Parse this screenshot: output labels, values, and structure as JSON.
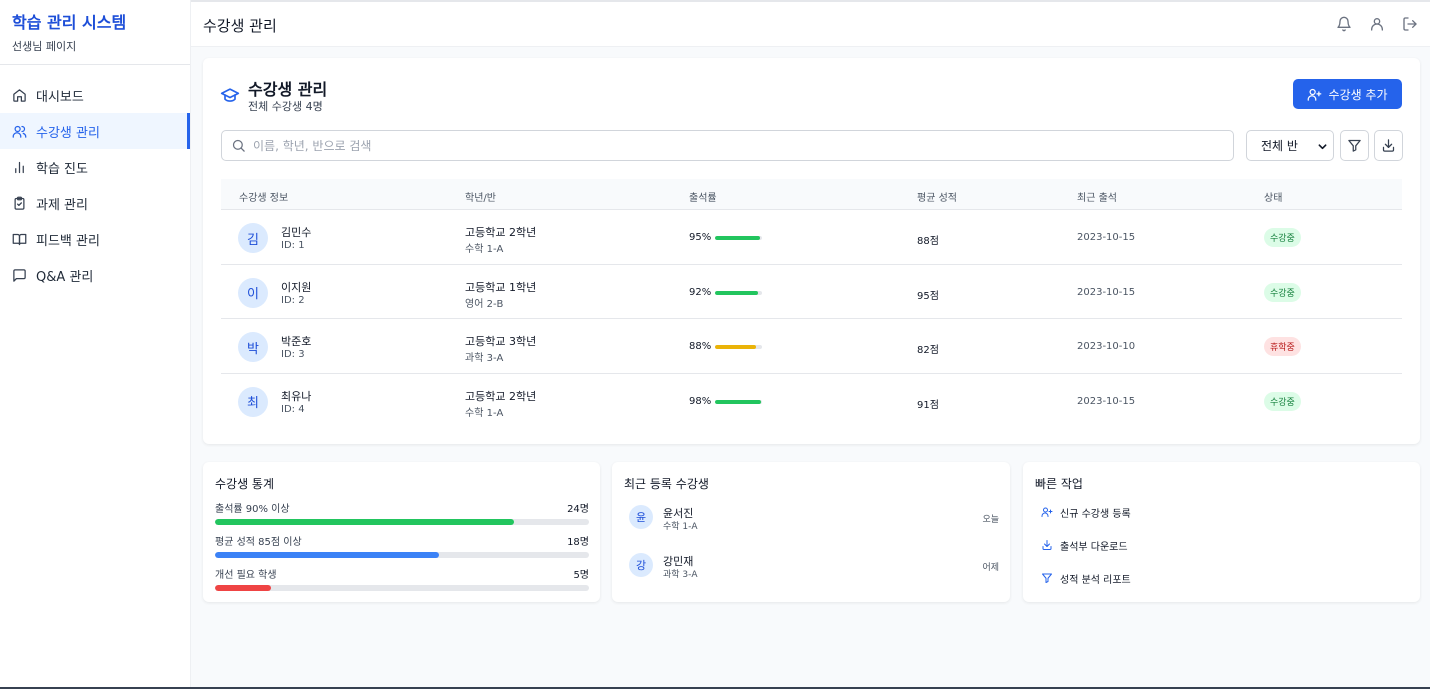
{
  "sidebar": {
    "brand_title": "학습 관리 시스템",
    "brand_sub": "선생님 페이지",
    "items": [
      {
        "label": "대시보드",
        "icon": "home-icon"
      },
      {
        "label": "수강생 관리",
        "icon": "users-icon",
        "active": true
      },
      {
        "label": "학습 진도",
        "icon": "bar-chart-icon"
      },
      {
        "label": "과제 관리",
        "icon": "clipboard-icon"
      },
      {
        "label": "피드백 관리",
        "icon": "book-icon"
      },
      {
        "label": "Q&A 관리",
        "icon": "message-icon"
      }
    ]
  },
  "header": {
    "title": "수강생 관리",
    "icons": [
      "bell-icon",
      "user-icon",
      "logout-icon"
    ]
  },
  "main": {
    "title": "수강생 관리",
    "subtitle": "전체 수강생 4명",
    "add_button": "수강생 추가",
    "search_placeholder": "이름, 학년, 반으로 검색",
    "select_value": "전체 반",
    "columns": [
      "수강생 정보",
      "학년/반",
      "출석률",
      "평균 성적",
      "최근 출석",
      "상태"
    ],
    "rows": [
      {
        "initial": "김",
        "name": "김민수",
        "id": "ID: 1",
        "grade": "고등학교 2학년",
        "class": "수학 1-A",
        "attendance": "95%",
        "attendance_value": 95,
        "score": "88점",
        "last": "2023-10-15",
        "status": "수강중",
        "status_type": "green",
        "bar_color": "#22c55e"
      },
      {
        "initial": "이",
        "name": "이지원",
        "id": "ID: 2",
        "grade": "고등학교 1학년",
        "class": "영어 2-B",
        "attendance": "92%",
        "attendance_value": 92,
        "score": "95점",
        "last": "2023-10-15",
        "status": "수강중",
        "status_type": "green",
        "bar_color": "#22c55e"
      },
      {
        "initial": "박",
        "name": "박준호",
        "id": "ID: 3",
        "grade": "고등학교 3학년",
        "class": "과학 3-A",
        "attendance": "88%",
        "attendance_value": 88,
        "score": "82점",
        "last": "2023-10-10",
        "status": "휴학중",
        "status_type": "red",
        "bar_color": "#eab308"
      },
      {
        "initial": "최",
        "name": "최유나",
        "id": "ID: 4",
        "grade": "고등학교 2학년",
        "class": "수학 1-A",
        "attendance": "98%",
        "attendance_value": 98,
        "score": "91점",
        "last": "2023-10-15",
        "status": "수강중",
        "status_type": "green",
        "bar_color": "#22c55e"
      }
    ]
  },
  "stats": {
    "title": "수강생 통계",
    "items": [
      {
        "label": "출석률 90% 이상",
        "value": "24명",
        "fraction": 0.8,
        "color": "#22c55e"
      },
      {
        "label": "평균 성적 85점 이상",
        "value": "18명",
        "fraction": 0.6,
        "color": "#3b82f6"
      },
      {
        "label": "개선 필요 학생",
        "value": "5명",
        "fraction": 0.15,
        "color": "#ef4444"
      }
    ]
  },
  "recent": {
    "title": "최근 등록 수강생",
    "items": [
      {
        "initial": "윤",
        "name": "윤서진",
        "class": "수학 1-A",
        "when": "오늘"
      },
      {
        "initial": "강",
        "name": "강민재",
        "class": "과학 3-A",
        "when": "어제"
      }
    ]
  },
  "quick": {
    "title": "빠른 작업",
    "items": [
      {
        "label": "신규 수강생 등록",
        "icon": "user-plus-icon"
      },
      {
        "label": "출석부 다운로드",
        "icon": "download-icon"
      },
      {
        "label": "성적 분석 리포트",
        "icon": "filter-icon"
      }
    ]
  },
  "colors": {
    "accent": "#2563eb"
  }
}
